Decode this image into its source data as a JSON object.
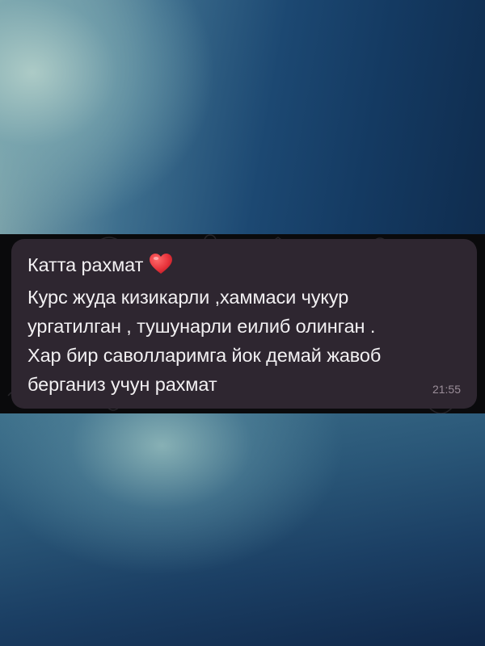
{
  "message": {
    "lines": [
      "Катта рахмат",
      "Курс жуда кизикарли ,хаммаси чукур",
      "ургатилган , тушунарли еилиб олинган .",
      "Хар бир саволларимга йок демай жавоб",
      "берганиз учун рахмат"
    ],
    "emoji": "heart-emoji",
    "time": "21:55"
  },
  "colors": {
    "bubble": "#2e2630",
    "chat_background": "#0a0a0c",
    "text": "#f2f0f2",
    "time": "#9b8e99",
    "heart": "#e8343c"
  }
}
